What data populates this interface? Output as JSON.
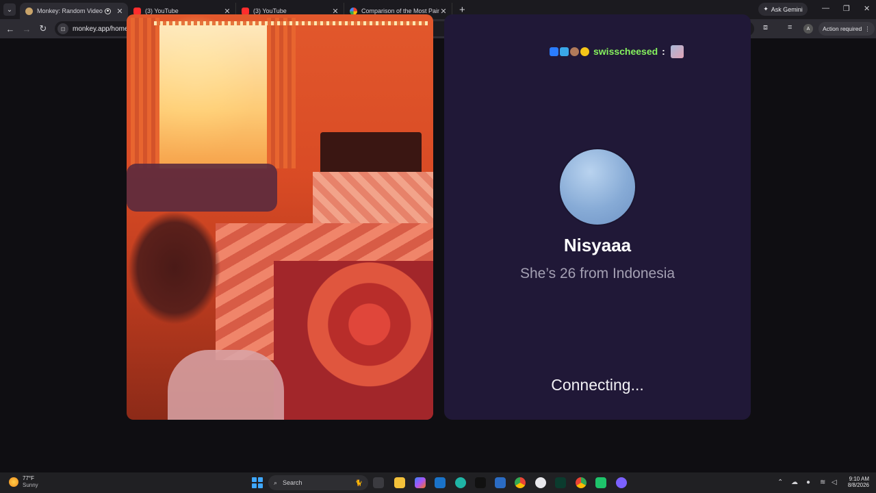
{
  "browser": {
    "tabs": [
      {
        "title": "Monkey: Random Video Chat",
        "active": true
      },
      {
        "title": "(3) YouTube",
        "active": false
      },
      {
        "title": "(3) YouTube",
        "active": false
      },
      {
        "title": "Comparison of the Most Painful",
        "active": false
      }
    ],
    "gemini_label": "Ask Gemini",
    "url": "monkey.app/home",
    "action_required": "Action required",
    "profile_initial": "A"
  },
  "chat": {
    "streamer": {
      "username": "swisscheesed",
      "separator": ":"
    },
    "peer": {
      "name": "Nisyaaa",
      "subtitle": "She’s 26 from Indonesia"
    },
    "status": "Connecting..."
  },
  "taskbar": {
    "weather_temp": "77°F",
    "weather_desc": "Sunny",
    "search_placeholder": "Search",
    "time": "9:10 AM",
    "date": "8/8/2026"
  },
  "colors": {
    "panel_bg": "#201837",
    "username_green": "#86f25e",
    "page_bg": "#0f0e12"
  }
}
